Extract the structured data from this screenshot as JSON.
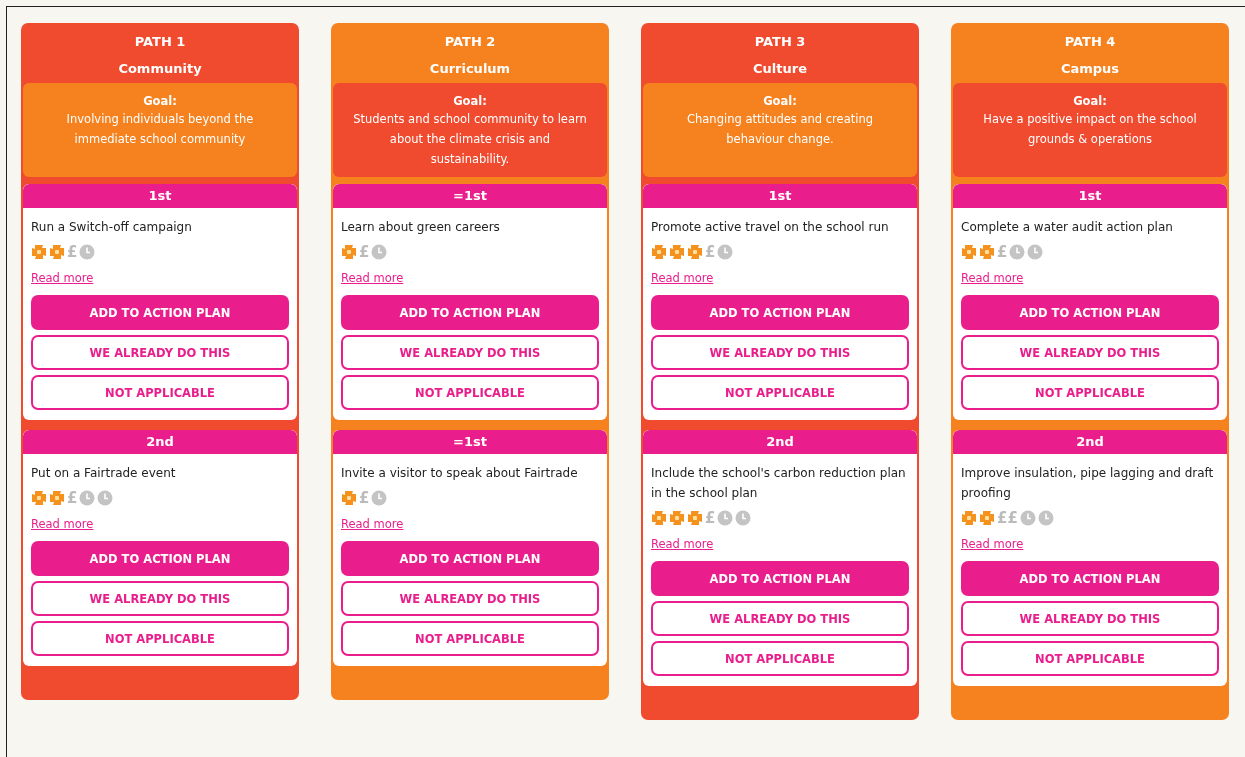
{
  "paths": [
    {
      "label": "PATH 1",
      "name": "Community",
      "color": "#f04a2f",
      "goal": {
        "color": "#f5821f",
        "label": "Goal:",
        "text": "Involving individuals beyond the immediate school community"
      },
      "actions": [
        {
          "rank": "1st",
          "title": "Run a Switch-off campaign",
          "icons": [
            {
              "kind": "impact"
            },
            {
              "kind": "impact"
            },
            {
              "kind": "cost",
              "text": "£"
            },
            {
              "kind": "time"
            }
          ],
          "link": "Read more",
          "buttons": [
            {
              "kind": "primary",
              "label": "ADD TO ACTION PLAN"
            },
            {
              "kind": "outline",
              "label": "WE ALREADY DO THIS"
            },
            {
              "kind": "outline",
              "label": "NOT APPLICABLE"
            }
          ]
        },
        {
          "rank": "2nd",
          "title": "Put on a Fairtrade event",
          "icons": [
            {
              "kind": "impact"
            },
            {
              "kind": "impact"
            },
            {
              "kind": "cost",
              "text": "£"
            },
            {
              "kind": "time"
            },
            {
              "kind": "time"
            }
          ],
          "link": "Read more",
          "buttons": [
            {
              "kind": "primary",
              "label": "ADD TO ACTION PLAN"
            },
            {
              "kind": "outline",
              "label": "WE ALREADY DO THIS"
            },
            {
              "kind": "outline",
              "label": "NOT APPLICABLE"
            }
          ]
        }
      ]
    },
    {
      "label": "PATH 2",
      "name": "Curriculum",
      "color": "#f5821f",
      "goal": {
        "color": "#f04a2f",
        "label": "Goal:",
        "text": "Students and school community to learn about the climate crisis and sustainability."
      },
      "actions": [
        {
          "rank": "=1st",
          "title": "Learn about green careers",
          "icons": [
            {
              "kind": "impact"
            },
            {
              "kind": "cost",
              "text": "£"
            },
            {
              "kind": "time"
            }
          ],
          "link": "Read more",
          "buttons": [
            {
              "kind": "primary",
              "label": "ADD TO ACTION PLAN"
            },
            {
              "kind": "outline",
              "label": "WE ALREADY DO THIS"
            },
            {
              "kind": "outline",
              "label": "NOT APPLICABLE"
            }
          ]
        },
        {
          "rank": "=1st",
          "title": "Invite a visitor to speak about Fairtrade",
          "icons": [
            {
              "kind": "impact"
            },
            {
              "kind": "cost",
              "text": "£"
            },
            {
              "kind": "time"
            }
          ],
          "link": "Read more",
          "buttons": [
            {
              "kind": "primary",
              "label": "ADD TO ACTION PLAN"
            },
            {
              "kind": "outline",
              "label": "WE ALREADY DO THIS"
            },
            {
              "kind": "outline",
              "label": "NOT APPLICABLE"
            }
          ]
        }
      ]
    },
    {
      "label": "PATH 3",
      "name": "Culture",
      "color": "#f04a2f",
      "goal": {
        "color": "#f5821f",
        "label": "Goal:",
        "text": "Changing attitudes and creating behaviour change."
      },
      "actions": [
        {
          "rank": "1st",
          "title": "Promote active travel on the school run",
          "icons": [
            {
              "kind": "impact"
            },
            {
              "kind": "impact"
            },
            {
              "kind": "impact"
            },
            {
              "kind": "cost",
              "text": "£"
            },
            {
              "kind": "time"
            }
          ],
          "link": "Read more",
          "buttons": [
            {
              "kind": "primary",
              "label": "ADD TO ACTION PLAN"
            },
            {
              "kind": "outline",
              "label": "WE ALREADY DO THIS"
            },
            {
              "kind": "outline",
              "label": "NOT APPLICABLE"
            }
          ]
        },
        {
          "rank": "2nd",
          "title": "Include the school's carbon reduction plan in the school plan",
          "icons": [
            {
              "kind": "impact"
            },
            {
              "kind": "impact"
            },
            {
              "kind": "impact"
            },
            {
              "kind": "cost",
              "text": "£"
            },
            {
              "kind": "time"
            },
            {
              "kind": "time"
            }
          ],
          "link": "Read more",
          "buttons": [
            {
              "kind": "primary",
              "label": "ADD TO ACTION PLAN"
            },
            {
              "kind": "outline",
              "label": "WE ALREADY DO THIS"
            },
            {
              "kind": "outline",
              "label": "NOT APPLICABLE"
            }
          ]
        }
      ]
    },
    {
      "label": "PATH 4",
      "name": "Campus",
      "color": "#f5821f",
      "goal": {
        "color": "#f04a2f",
        "label": "Goal:",
        "text": "Have a positive impact on the school grounds & operations"
      },
      "actions": [
        {
          "rank": "1st",
          "title": "Complete a water audit action plan",
          "icons": [
            {
              "kind": "impact"
            },
            {
              "kind": "impact"
            },
            {
              "kind": "cost",
              "text": "£"
            },
            {
              "kind": "time"
            },
            {
              "kind": "time"
            }
          ],
          "link": "Read more",
          "buttons": [
            {
              "kind": "primary",
              "label": "ADD TO ACTION PLAN"
            },
            {
              "kind": "outline",
              "label": "WE ALREADY DO THIS"
            },
            {
              "kind": "outline",
              "label": "NOT APPLICABLE"
            }
          ]
        },
        {
          "rank": "2nd",
          "title": "Improve insulation, pipe lagging and draft proofing",
          "icons": [
            {
              "kind": "impact"
            },
            {
              "kind": "impact"
            },
            {
              "kind": "cost",
              "text": "££"
            },
            {
              "kind": "time"
            },
            {
              "kind": "time"
            }
          ],
          "link": "Read more",
          "buttons": [
            {
              "kind": "primary",
              "label": "ADD TO ACTION PLAN"
            },
            {
              "kind": "outline",
              "label": "WE ALREADY DO THIS"
            },
            {
              "kind": "outline",
              "label": "NOT APPLICABLE"
            }
          ]
        }
      ]
    }
  ]
}
